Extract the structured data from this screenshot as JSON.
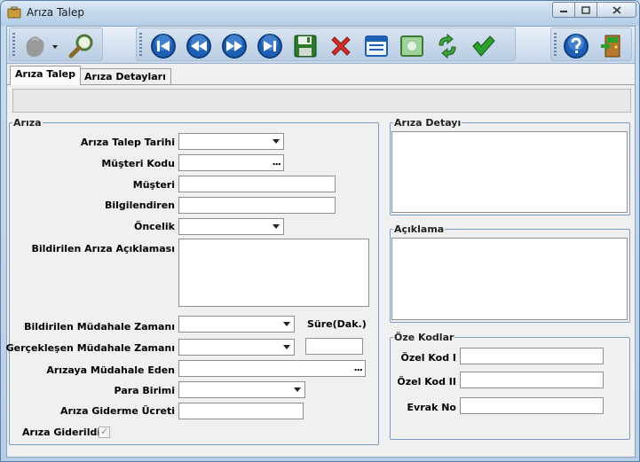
{
  "window": {
    "title": "Arıza Talep",
    "controls": {
      "minimize": "minimize-icon",
      "maximize": "maximize-icon",
      "close": "close-icon"
    }
  },
  "toolbar": {
    "buttons": [
      {
        "name": "filter-icon"
      },
      {
        "name": "search-icon"
      },
      {
        "name": "first-record-icon"
      },
      {
        "name": "previous-record-icon"
      },
      {
        "name": "next-record-icon"
      },
      {
        "name": "last-record-icon"
      },
      {
        "name": "save-icon"
      },
      {
        "name": "delete-icon"
      },
      {
        "name": "form-view-icon"
      },
      {
        "name": "note-icon"
      },
      {
        "name": "refresh-icon"
      },
      {
        "name": "approve-icon"
      },
      {
        "name": "help-icon"
      },
      {
        "name": "exit-icon"
      }
    ]
  },
  "tabs": [
    {
      "label": "Arıza Talep",
      "active": true
    },
    {
      "label": "Arıza Detayları",
      "active": false
    }
  ],
  "ariza_group": {
    "legend": "Arıza",
    "fields": {
      "talep_tarihi": "Arıza Talep Tarihi",
      "musteri_kodu": "Müşteri Kodu",
      "musteri": "Müşteri",
      "bilgilendiren": "Bilgilendiren",
      "oncelik": "Öncelik",
      "aciklama": "Bildirilen Arıza Açıklaması",
      "mudahale_zamani": "Bildirilen Müdahale Zamanı",
      "sure": "Süre(Dak.)",
      "gerceklesen": "Gerçekleşen Müdahale Zamanı",
      "mudahale_eden": "Arızaya Müdahale Eden",
      "para_birimi": "Para Birimi",
      "giderme_ucreti": "Arıza Giderme Ücreti",
      "giderildi": "Arıza Giderildi"
    },
    "ellipsis": "..."
  },
  "detay_group": {
    "legend": "Arıza Detayı"
  },
  "aciklama_group": {
    "legend": "Açıklama"
  },
  "ozel_kodlar": {
    "legend": "Öze Kodlar",
    "kod1": "Özel Kod I",
    "kod2": "Özel Kod II",
    "evrak": "Evrak No"
  },
  "colors": {
    "accent": "#1d5fb4",
    "delete": "#d0302a",
    "approve": "#2aa12a",
    "group_border": "#7b9bc7"
  }
}
